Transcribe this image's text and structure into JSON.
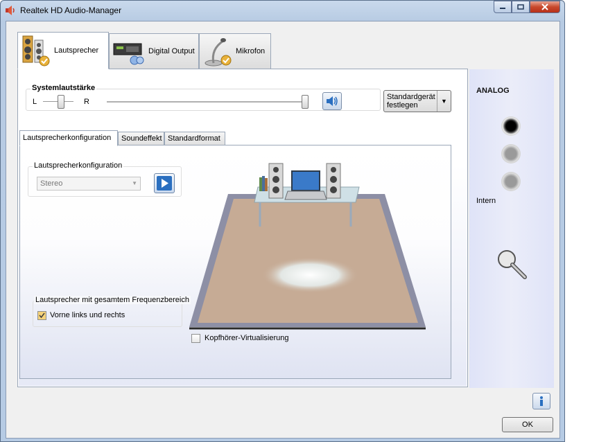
{
  "window": {
    "title": "Realtek HD Audio-Manager"
  },
  "top_tabs": [
    {
      "label": "Lautsprecher",
      "icon": "speakers-icon",
      "active": true
    },
    {
      "label": "Digital Output",
      "icon": "digital-output-icon",
      "active": false
    },
    {
      "label": "Mikrofon",
      "icon": "microphone-icon",
      "active": false
    }
  ],
  "volume": {
    "title": "Systemlautstärke",
    "left_label": "L",
    "right_label": "R",
    "balance_level": 0.5,
    "volume_level": 1.0
  },
  "default_device_button": {
    "line1": "Standardgerät",
    "line2": "festlegen"
  },
  "sub_tabs": [
    {
      "label": "Lautsprecherkonfiguration",
      "active": true
    },
    {
      "label": "Soundeffekt",
      "active": false
    },
    {
      "label": "Standardformat",
      "active": false
    }
  ],
  "speaker_config": {
    "group_title": "Lautsprecherkonfiguration",
    "selected": "Stereo"
  },
  "full_range": {
    "group_title": "Lautsprecher mit gesamtem Frequenzbereich",
    "option_label": "Vorne links und rechts",
    "option_checked": true
  },
  "headphone_virtualization": {
    "label": "Kopfhörer-Virtualisierung",
    "checked": false
  },
  "analog_panel": {
    "title": "ANALOG",
    "intern_label": "Intern",
    "colors": {
      "active_jack": "#111111",
      "inactive_jack": "#9a9a9a"
    }
  },
  "buttons": {
    "ok": "OK"
  },
  "colors": {
    "room_floor": "#c6ab95",
    "room_frame": "#8d8fa5",
    "accent_blue": "#2a6fc0"
  }
}
